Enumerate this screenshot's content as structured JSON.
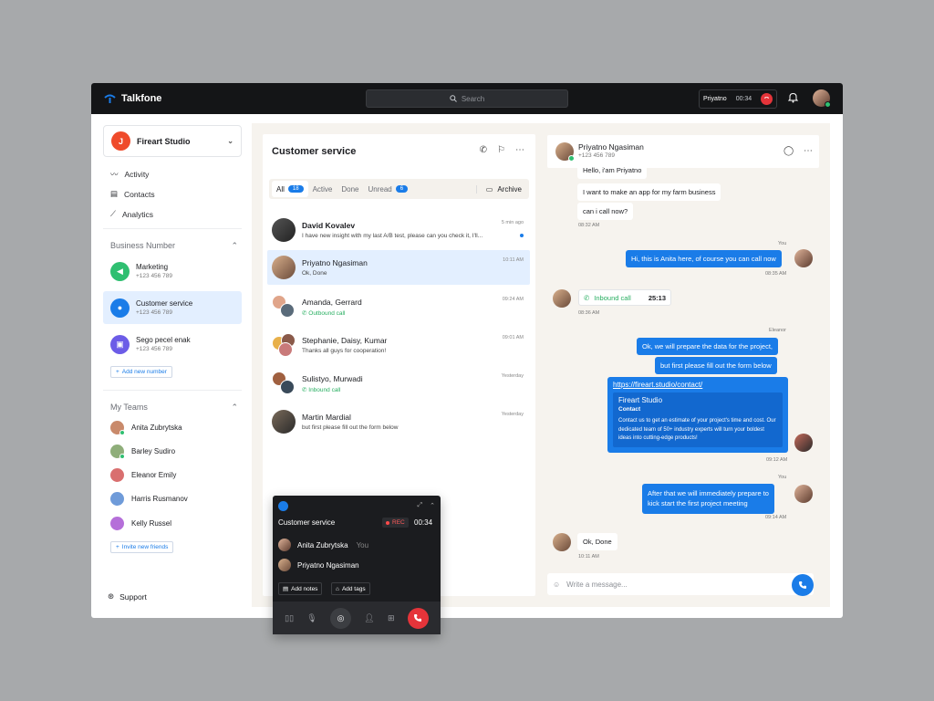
{
  "app": {
    "name": "Talkfone",
    "search_placeholder": "Search",
    "active_call": {
      "name": "Priyatno",
      "time": "00:34"
    }
  },
  "sidebar": {
    "org": "Fireart Studio",
    "org_initial": "J",
    "nav": [
      {
        "label": "Activity",
        "icon": "activity-icon"
      },
      {
        "label": "Contacts",
        "icon": "contacts-icon"
      },
      {
        "label": "Analytics",
        "icon": "analytics-icon"
      }
    ],
    "business_header": "Business Number",
    "business": [
      {
        "name": "Marketing",
        "phone": "+123 456 789",
        "color": "#2fbf71"
      },
      {
        "name": "Customer service",
        "phone": "+123 456 789",
        "color": "#1a7ce8"
      },
      {
        "name": "Sego pecel enak",
        "phone": "+123 456 789",
        "color": "#6c5ce7"
      }
    ],
    "add_number": "Add new number",
    "teams_header": "My Teams",
    "teams": [
      "Anita Zubrytska",
      "Barley Sudiro",
      "Eleanor Emily",
      "Harris Rusmanov",
      "Kelly Russel"
    ],
    "invite": "Invite new friends",
    "support": "Support"
  },
  "chatlist": {
    "title": "Customer service",
    "tabs": {
      "all": "All",
      "all_count": "18",
      "active": "Active",
      "done": "Done",
      "unread": "Unread",
      "unread_count": "6",
      "archive": "Archive"
    },
    "rows": [
      {
        "name": "David Kovalev",
        "msg": "I have new insight with my last A/B test, please can you check it, I'll...",
        "time": "5 min ago"
      },
      {
        "name": "Priyatno Ngasiman",
        "msg": "Ok, Done",
        "time": "10:11 AM"
      },
      {
        "name": "Amanda, Gerrard",
        "msg": "Outbound call",
        "time": "09:24 AM"
      },
      {
        "name": "Stephanie, Daisy, Kumar",
        "msg": "Thanks all guys for cooperation!",
        "time": "09:01 AM"
      },
      {
        "name": "Sulistyo, Murwadi",
        "msg": "Inbound call",
        "time": "Yesterday"
      },
      {
        "name": "Martin Mardial",
        "msg": "but first please fill out the form below",
        "time": "Yesterday"
      }
    ]
  },
  "chat": {
    "contact": "Priyatno Ngasiman",
    "phone": "+123 456 789",
    "m1": "Hello, i'am Priyatno",
    "m2": "I want to make an app for my farm business",
    "m3": "can i call now?",
    "t1": "08:32 AM",
    "you": "You",
    "m4": "Hi, this is Anita here, of course you can call now",
    "t2": "08:35 AM",
    "inbound": "Inbound call",
    "inbound_dur": "25:13",
    "t3": "08:36 AM",
    "eleanor": "Eleanor",
    "m5": "Ok, we will prepare the data for the project,",
    "m6": "but first please fill out the form below",
    "link": "https://fireart.studio/contact/",
    "card_title": "Fireart Studio",
    "card_sub": "Contact",
    "card_text": "Contact us to get an estimate of your project's time and cost. Our dedicated team of 50+ industry experts will turn your boldest ideas into cutting-edge products!",
    "t4": "09:12 AM",
    "you2": "You",
    "m7a": "After that we will immediately prepare to",
    "m7b": "kick start the first project meeting",
    "t5": "09:14 AM",
    "m8": "Ok, Done",
    "t6": "10:11 AM",
    "composer": "Write a message..."
  },
  "call": {
    "title": "Customer service",
    "rec": "REC",
    "time": "00:34",
    "p1": "Anita Zubrytska",
    "you": "You",
    "p2": "Priyatno Ngasiman",
    "notes": "Add notes",
    "tags": "Add tags"
  }
}
